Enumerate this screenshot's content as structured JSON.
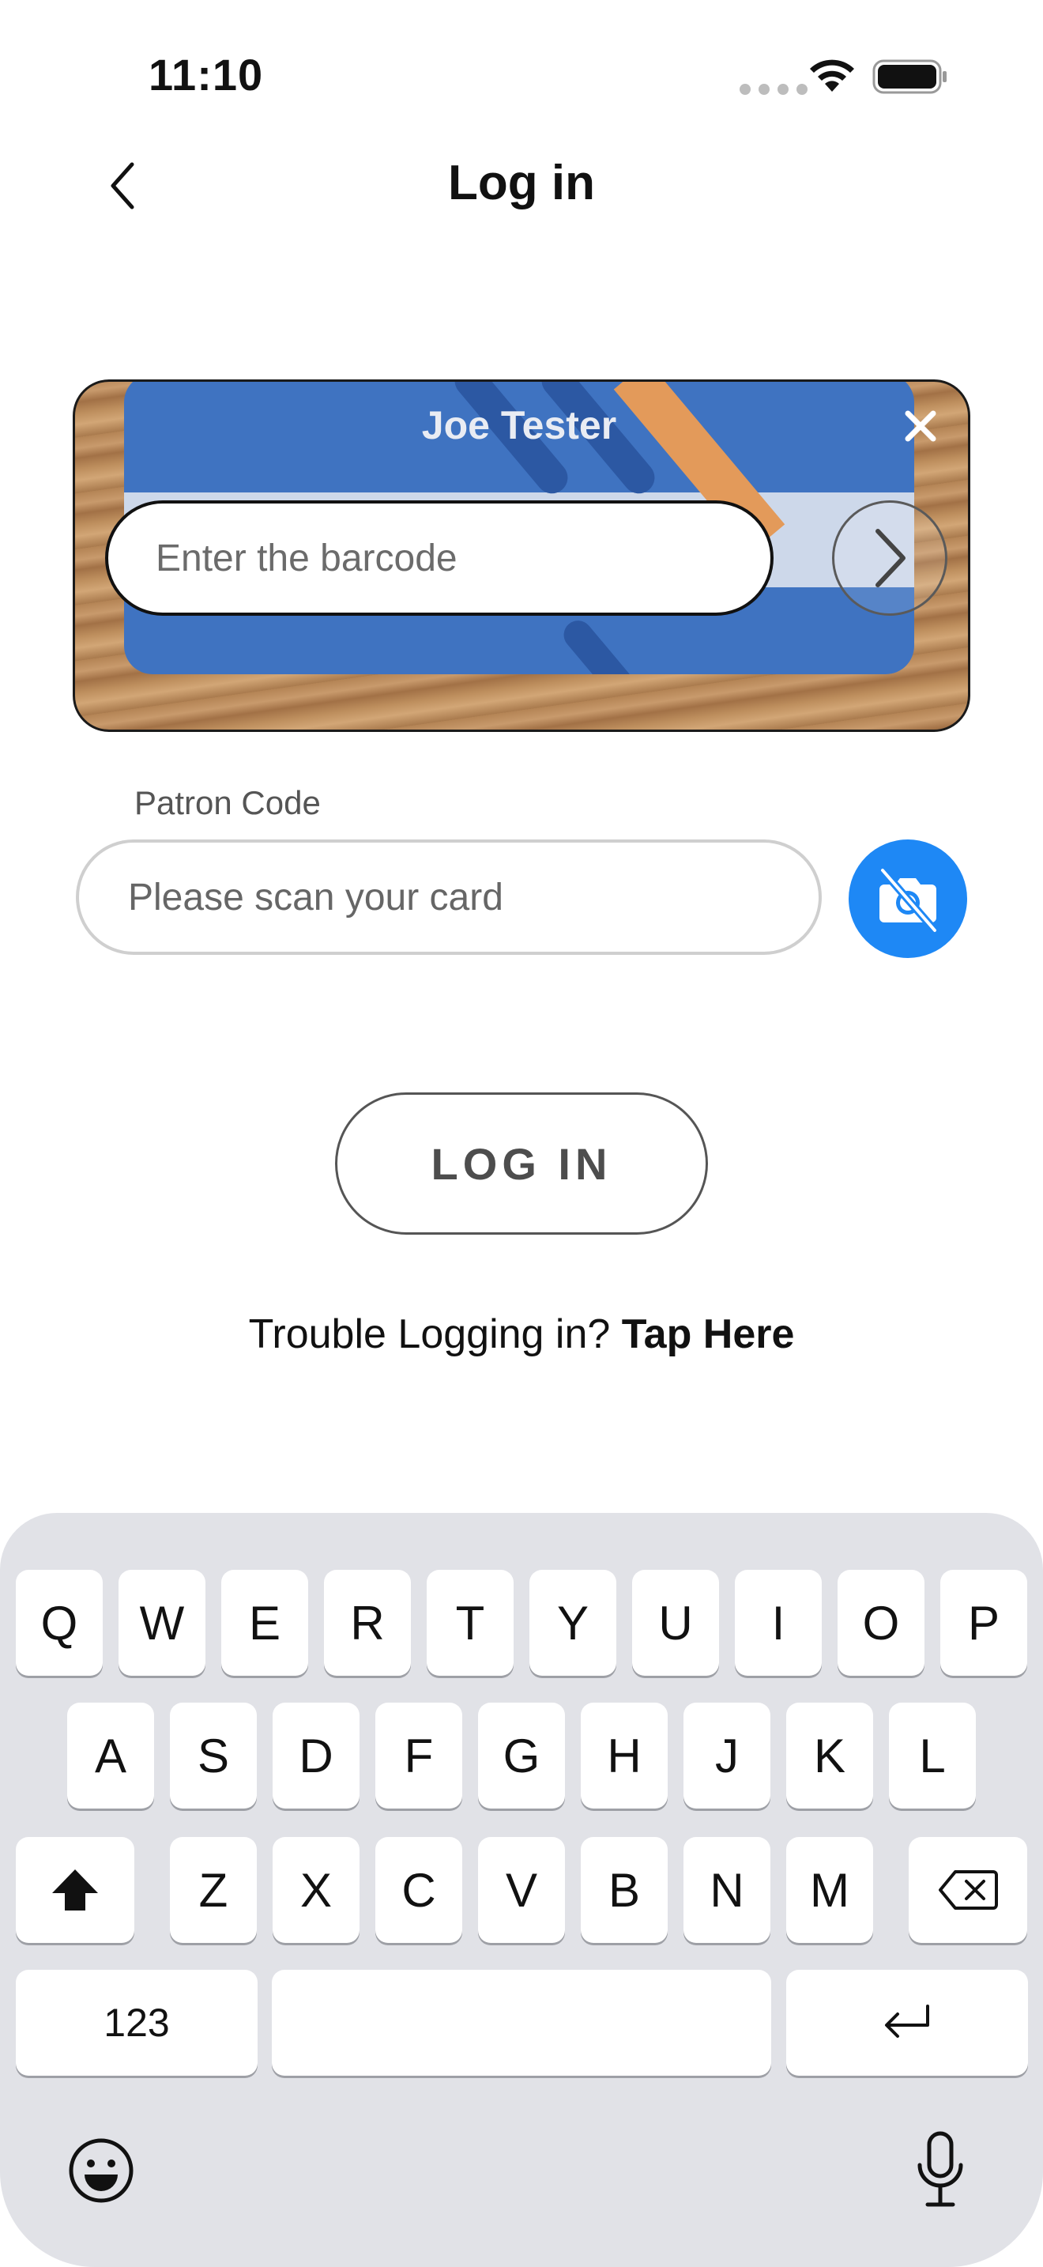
{
  "status_bar": {
    "time": "11:10"
  },
  "nav": {
    "title": "Log in"
  },
  "scanner": {
    "card_name": "Joe Tester",
    "barcode_placeholder": "Enter the barcode"
  },
  "patron": {
    "label": "Patron Code",
    "placeholder": "Please scan your card"
  },
  "login": {
    "button_label": "LOG IN",
    "trouble_text": "Trouble Logging in?",
    "trouble_link": "Tap Here"
  },
  "colors": {
    "accent_blue": "#1e88f5",
    "keyboard_bg": "#e1e2e7"
  },
  "keyboard": {
    "row1": [
      "Q",
      "W",
      "E",
      "R",
      "T",
      "Y",
      "U",
      "I",
      "O",
      "P"
    ],
    "row2": [
      "A",
      "S",
      "D",
      "F",
      "G",
      "H",
      "J",
      "K",
      "L"
    ],
    "row3": [
      "Z",
      "X",
      "C",
      "V",
      "B",
      "N",
      "M"
    ],
    "numbers_key": "123",
    "icons": [
      "shift-icon",
      "delete-icon",
      "return-icon",
      "emoji-icon",
      "microphone-icon"
    ]
  }
}
